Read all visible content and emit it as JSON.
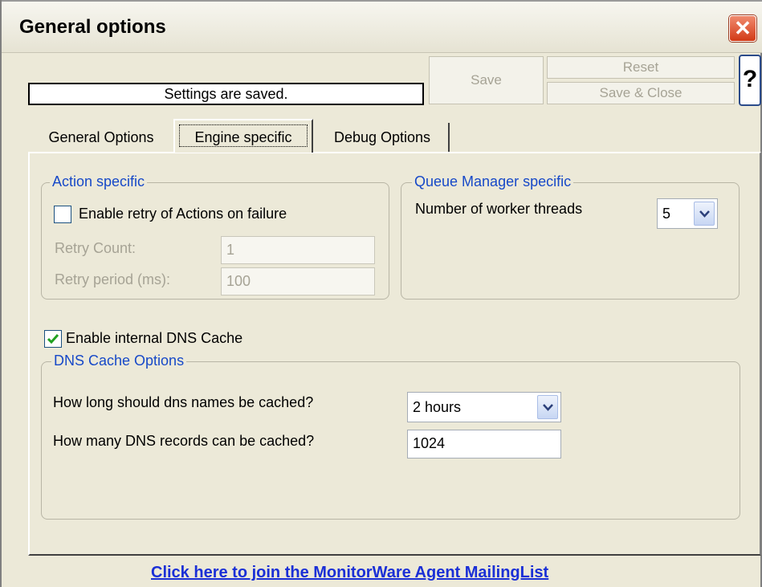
{
  "window": {
    "title": "General options",
    "close_icon": "close-icon"
  },
  "status": {
    "text": "Settings are saved."
  },
  "toolbar": {
    "save_label": "Save",
    "reset_label": "Reset",
    "save_close_label": "Save & Close",
    "help_label": "?"
  },
  "tabs": [
    {
      "label": "General Options"
    },
    {
      "label": "Engine specific",
      "selected": true
    },
    {
      "label": "Debug Options"
    }
  ],
  "action_specific": {
    "legend": "Action specific",
    "retry_checkbox_label": "Enable retry of Actions on failure",
    "retry_checked": false,
    "retry_count_label": "Retry Count:",
    "retry_count_value": "1",
    "retry_period_label": "Retry period (ms):",
    "retry_period_value": "100"
  },
  "queue_manager": {
    "legend": "Queue Manager specific",
    "threads_label": "Number of worker threads",
    "threads_value": "5"
  },
  "dns": {
    "enable_label": "Enable internal DNS Cache",
    "enable_checked": true,
    "legend": "DNS Cache Options",
    "duration_label": "How long should dns names be cached?",
    "duration_value": "2 hours",
    "records_label": "How many DNS records can be cached?",
    "records_value": "1024"
  },
  "footer": {
    "link_text": "Click here to join the MonitorWare Agent MailingList"
  },
  "colors": {
    "legend": "#1749c8",
    "link": "#1a2fd6",
    "background": "#ece9d8",
    "close": "#d23a16"
  }
}
